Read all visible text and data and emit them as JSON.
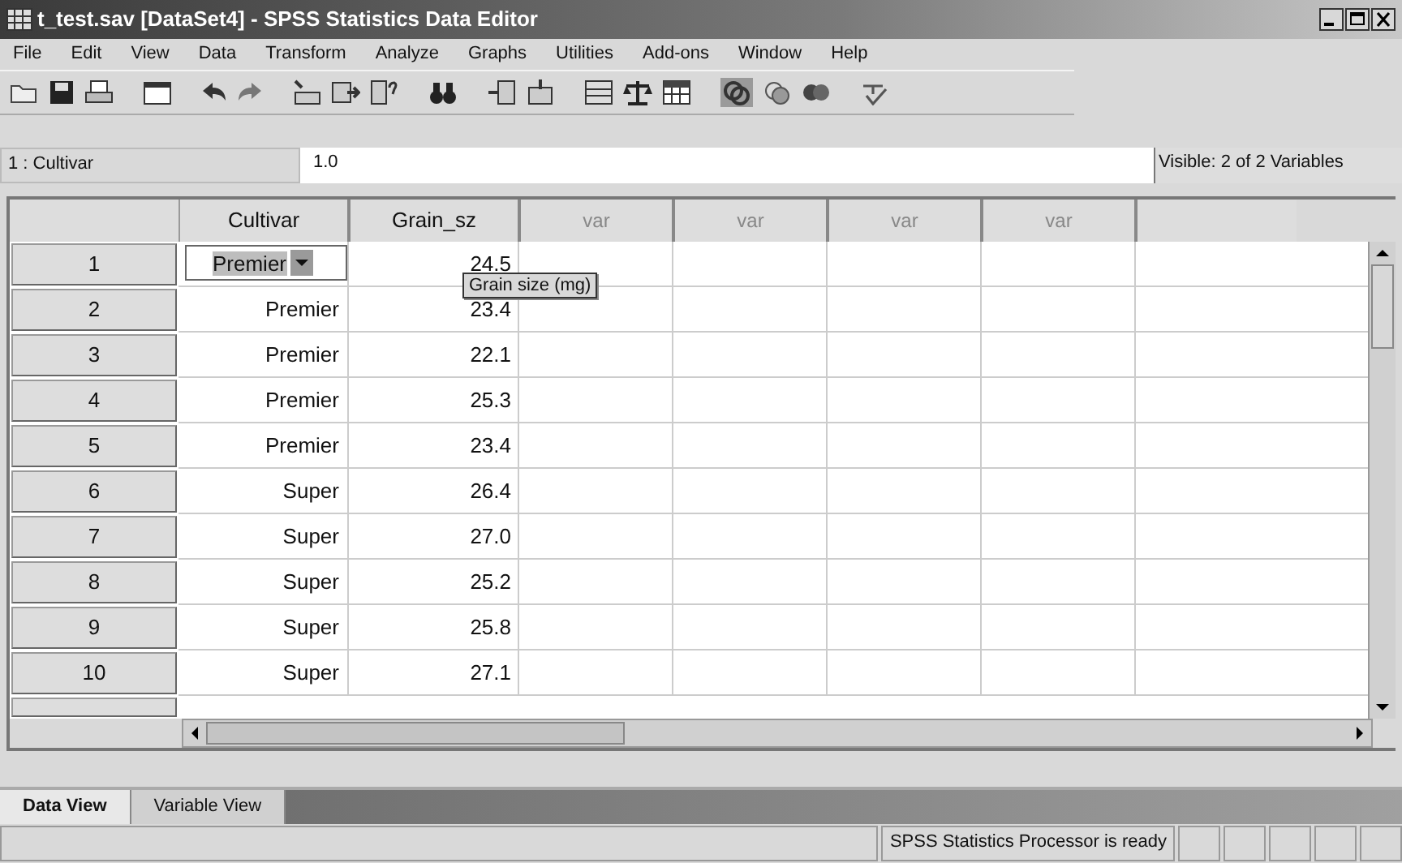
{
  "window": {
    "title": "t_test.sav [DataSet4] - SPSS Statistics Data Editor"
  },
  "menu": [
    "File",
    "Edit",
    "View",
    "Data",
    "Transform",
    "Analyze",
    "Graphs",
    "Utilities",
    "Add-ons",
    "Window",
    "Help"
  ],
  "cell_editor": {
    "reference": "1 : Cultivar",
    "value": "1.0",
    "visible": "Visible: 2 of 2 Variables"
  },
  "grid": {
    "columns": [
      "Cultivar",
      "Grain_sz",
      "var",
      "var",
      "var",
      "var"
    ],
    "rows": [
      {
        "number": "1",
        "cultivar": "Premier",
        "grain_sz": "24.5",
        "editing": true
      },
      {
        "number": "2",
        "cultivar": "Premier",
        "grain_sz": "23.4",
        "editing": false
      },
      {
        "number": "3",
        "cultivar": "Premier",
        "grain_sz": "22.1",
        "editing": false
      },
      {
        "number": "4",
        "cultivar": "Premier",
        "grain_sz": "25.3",
        "editing": false
      },
      {
        "number": "5",
        "cultivar": "Premier",
        "grain_sz": "23.4",
        "editing": false
      },
      {
        "number": "6",
        "cultivar": "Super",
        "grain_sz": "26.4",
        "editing": false
      },
      {
        "number": "7",
        "cultivar": "Super",
        "grain_sz": "27.0",
        "editing": false
      },
      {
        "number": "8",
        "cultivar": "Super",
        "grain_sz": "25.2",
        "editing": false
      },
      {
        "number": "9",
        "cultivar": "Super",
        "grain_sz": "25.8",
        "editing": false
      },
      {
        "number": "10",
        "cultivar": "Super",
        "grain_sz": "27.1",
        "editing": false
      }
    ],
    "tooltip": "Grain size (mg)"
  },
  "tabs": [
    {
      "label": "Data View",
      "selected": true
    },
    {
      "label": "Variable View",
      "selected": false
    }
  ],
  "status_bar": {
    "message": "SPSS Statistics  Processor is ready"
  }
}
